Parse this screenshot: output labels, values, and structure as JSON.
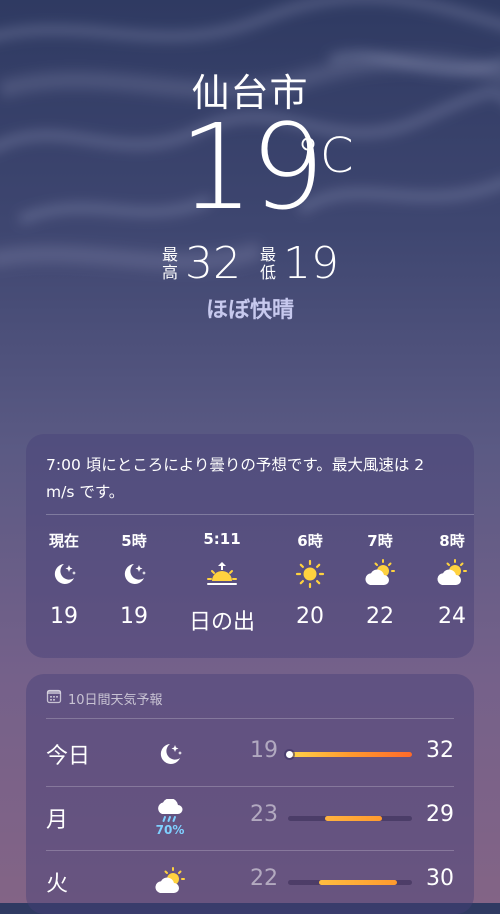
{
  "header": {
    "city": "仙台市",
    "temperature": "19",
    "unit": "°C",
    "high_label": "最高",
    "high_value": "32",
    "low_label": "最低",
    "low_value": "19",
    "condition": "ほぼ快晴"
  },
  "hourly": {
    "summary": "7:00 頃にところにより曇りの予想です。最大風速は 2 m/s です。",
    "items": [
      {
        "label": "現在",
        "icon": "moon-stars-icon",
        "temp": "19"
      },
      {
        "label": "5時",
        "icon": "moon-stars-icon",
        "temp": "19"
      },
      {
        "label": "5:11",
        "icon": "sunrise-icon",
        "temp": "日の出"
      },
      {
        "label": "6時",
        "icon": "sun-icon",
        "temp": "20"
      },
      {
        "label": "7時",
        "icon": "partly-cloudy-icon",
        "temp": "22"
      },
      {
        "label": "8時",
        "icon": "partly-cloudy-icon",
        "temp": "24"
      }
    ]
  },
  "forecast": {
    "title": "10日間天気予報",
    "rows": [
      {
        "day": "今日",
        "icon": "moon-stars-icon",
        "precip": "",
        "low": "19",
        "high": "32",
        "bar_start": 0.0,
        "bar_end": 1.0,
        "current_dot": 0.0
      },
      {
        "day": "月",
        "icon": "cloud-rain-icon",
        "precip": "70%",
        "low": "23",
        "high": "29",
        "bar_start": 0.3,
        "bar_end": 0.75
      },
      {
        "day": "火",
        "icon": "partly-cloudy-icon",
        "precip": "",
        "low": "22",
        "high": "30",
        "bar_start": 0.25,
        "bar_end": 0.88
      }
    ]
  },
  "colors": {
    "accent_precip": "#7fd0ff",
    "sun": "#ffd23f"
  }
}
